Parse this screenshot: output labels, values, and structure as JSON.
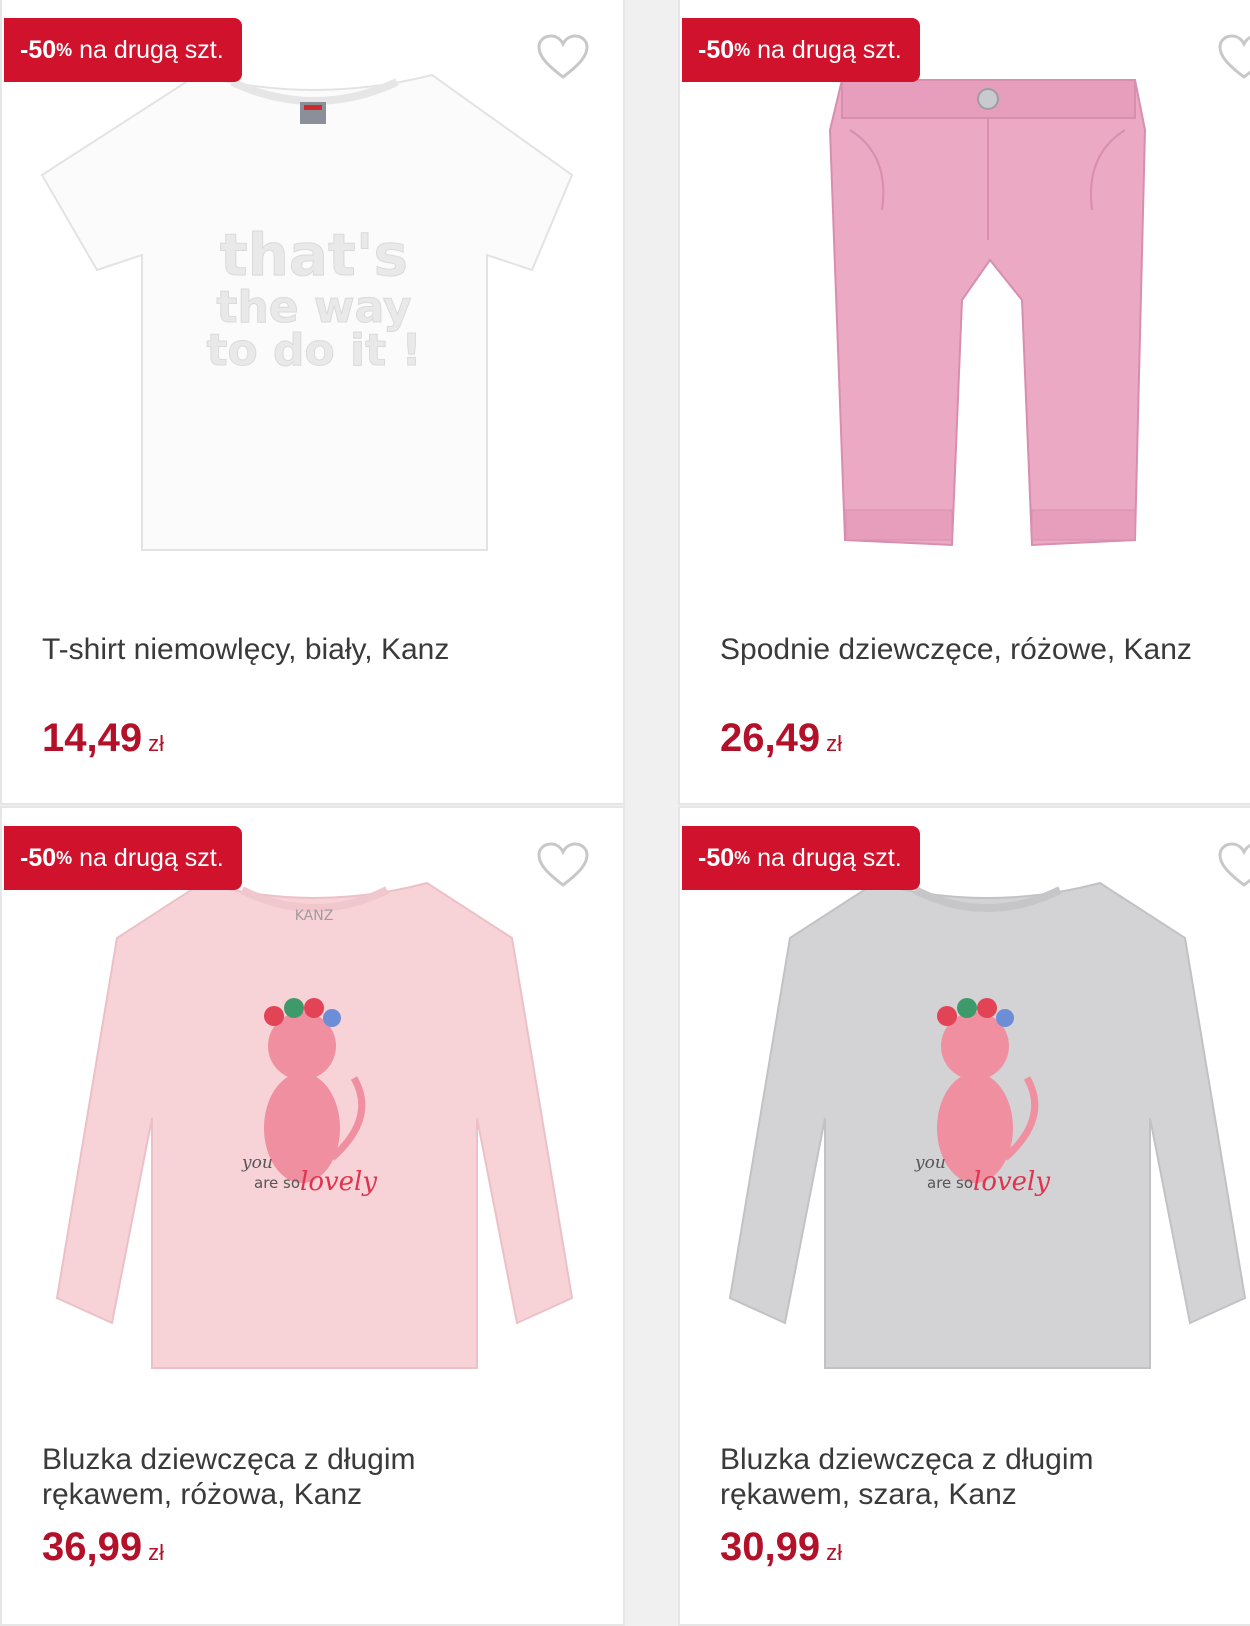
{
  "products": [
    {
      "badge": {
        "percent": "-50",
        "percent_sign": "%",
        "text": "na drugą szt."
      },
      "image": "white-tshirt-product-photo",
      "image_print": [
        "that's",
        "the way",
        "to do it !"
      ],
      "title": [
        "T-shirt niemowlęcy, biały, Kanz"
      ],
      "price": "14,49",
      "currency": "zł",
      "favorite_icon": "heart-outline-icon"
    },
    {
      "badge": {
        "percent": "-50",
        "percent_sign": "%",
        "text": "na drugą szt."
      },
      "image": "pink-trousers-product-photo",
      "title": [
        "Spodnie dziewczęce, różowe, Kanz"
      ],
      "price": "26,49",
      "currency": "zł",
      "favorite_icon": "heart-outline-icon"
    },
    {
      "badge": {
        "percent": "-50",
        "percent_sign": "%",
        "text": "na drugą szt."
      },
      "image": "pink-longsleeve-cat-product-photo",
      "image_print": [
        "KANZ",
        "you",
        "are so",
        "lovely"
      ],
      "title": [
        "Bluzka dziewczęca z długim",
        "rękawem, różowa, Kanz"
      ],
      "price": "36,99",
      "currency": "zł",
      "favorite_icon": "heart-outline-icon"
    },
    {
      "badge": {
        "percent": "-50",
        "percent_sign": "%",
        "text": "na drugą szt."
      },
      "image": "grey-longsleeve-cat-product-photo",
      "image_print": [
        "you",
        "are so",
        "lovely"
      ],
      "title": [
        "Bluzka dziewczęca z długim",
        "rękawem, szara, Kanz"
      ],
      "price": "30,99",
      "currency": "zł",
      "favorite_icon": "heart-outline-icon"
    }
  ],
  "colors": {
    "badge": "#d0122d",
    "price": "#b3102a",
    "title": "#3a3a3a",
    "background": "#f0f0f0",
    "card": "#ffffff"
  }
}
